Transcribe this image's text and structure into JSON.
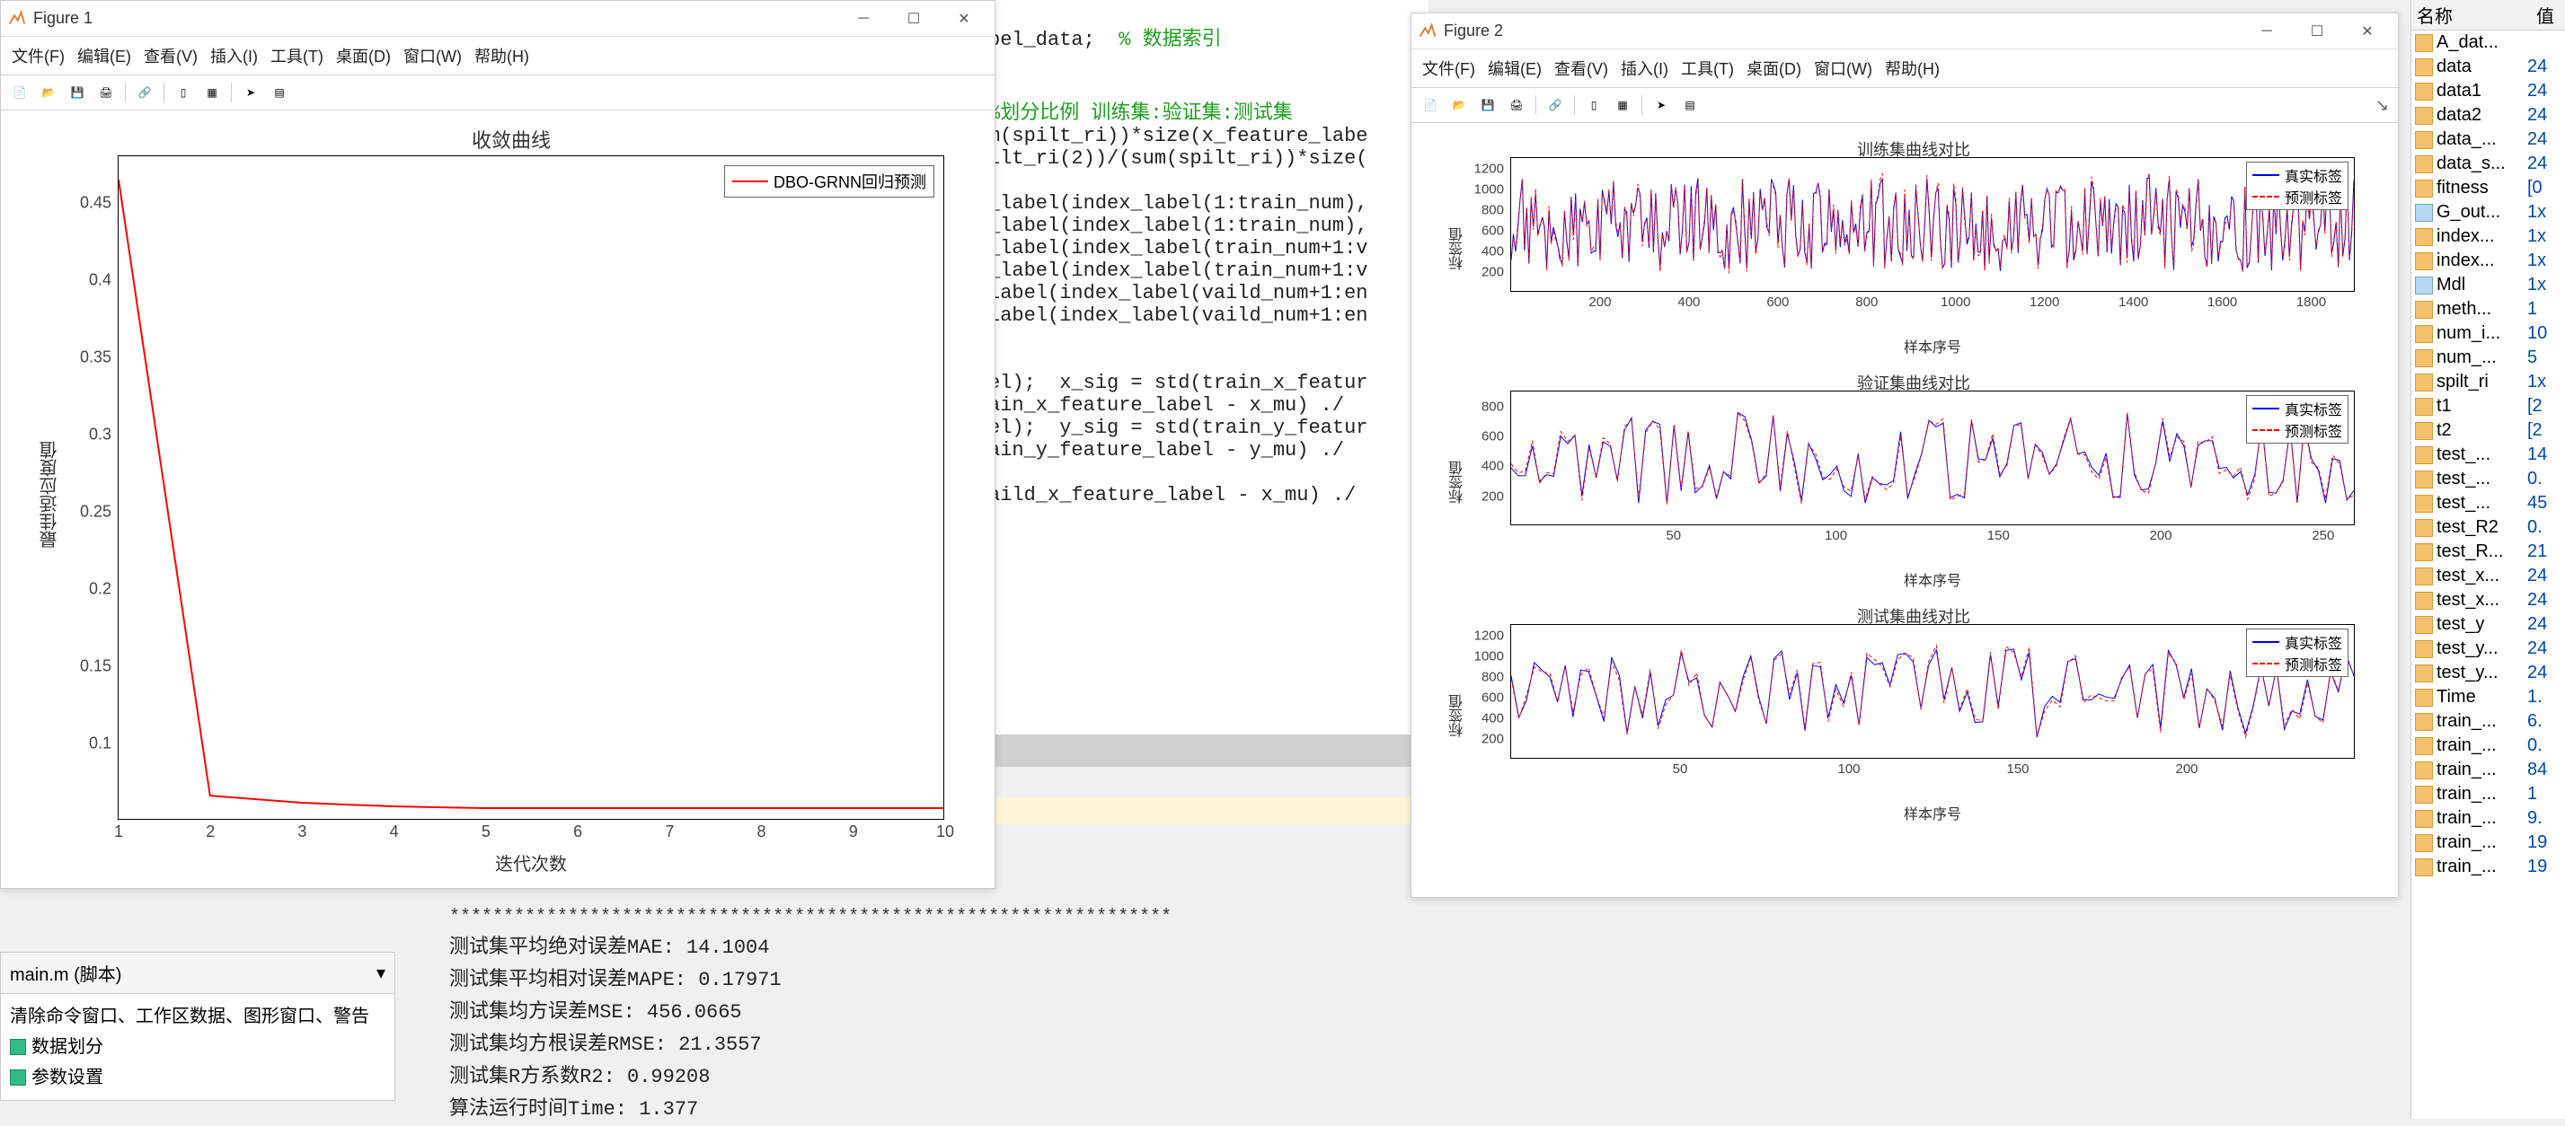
{
  "figure1": {
    "title": "Figure 1",
    "menu": [
      "文件(F)",
      "编辑(E)",
      "查看(V)",
      "插入(I)",
      "工具(T)",
      "桌面(D)",
      "窗口(W)",
      "帮助(H)"
    ]
  },
  "figure2": {
    "title": "Figure 2",
    "menu": [
      "文件(F)",
      "编辑(E)",
      "查看(V)",
      "插入(I)",
      "工具(T)",
      "桌面(D)",
      "窗口(W)",
      "帮助(H)"
    ]
  },
  "chart_data": [
    {
      "type": "line",
      "title": "收敛曲线",
      "xlabel": "迭代次数",
      "ylabel": "最佳适应度值",
      "xlim": [
        1,
        10
      ],
      "ylim": [
        0.05,
        0.48
      ],
      "xticks": [
        1,
        2,
        3,
        4,
        5,
        6,
        7,
        8,
        9,
        10
      ],
      "yticks": [
        0.1,
        0.15,
        0.2,
        0.25,
        0.3,
        0.35,
        0.4,
        0.45
      ],
      "series": [
        {
          "name": "DBO-GRNN回归预测",
          "color": "#ff0000",
          "x": [
            1,
            2,
            3,
            4,
            5,
            6,
            7,
            8,
            9,
            10
          ],
          "values": [
            0.465,
            0.065,
            0.06,
            0.058,
            0.057,
            0.057,
            0.057,
            0.057,
            0.057,
            0.057
          ]
        }
      ]
    },
    {
      "type": "line",
      "title": "训练集曲线对比",
      "xlabel": "样本序号",
      "ylabel": "标签值",
      "xlim": [
        0,
        1900
      ],
      "ylim": [
        0,
        1300
      ],
      "xticks": [
        200,
        400,
        600,
        800,
        1000,
        1200,
        1400,
        1600,
        1800
      ],
      "yticks": [
        200,
        400,
        600,
        800,
        1000,
        1200
      ],
      "series": [
        {
          "name": "真实标签",
          "color": "#0000ff",
          "style": "solid"
        },
        {
          "name": "预测标签",
          "color": "#ff0000",
          "style": "dashed"
        }
      ]
    },
    {
      "type": "line",
      "title": "验证集曲线对比",
      "xlabel": "样本序号",
      "ylabel": "标签值",
      "xlim": [
        0,
        260
      ],
      "ylim": [
        0,
        900
      ],
      "xticks": [
        50,
        100,
        150,
        200,
        250
      ],
      "yticks": [
        200,
        400,
        600,
        800
      ],
      "series": [
        {
          "name": "真实标签",
          "color": "#0000ff",
          "style": "solid"
        },
        {
          "name": "预测标签",
          "color": "#ff0000",
          "style": "dashed"
        }
      ]
    },
    {
      "type": "line",
      "title": "测试集曲线对比",
      "xlabel": "样本序号",
      "ylabel": "标签值",
      "xlim": [
        0,
        250
      ],
      "ylim": [
        0,
        1300
      ],
      "xticks": [
        50,
        100,
        150,
        200
      ],
      "yticks": [
        200,
        400,
        600,
        800,
        1000,
        1200
      ],
      "series": [
        {
          "name": "真实标签",
          "color": "#0000ff",
          "style": "solid"
        },
        {
          "name": "预测标签",
          "color": "#ff0000",
          "style": "dashed"
        }
      ]
    }
  ],
  "code": {
    "l1a": "bel_data;  ",
    "l1b": "% 数据索引",
    "l2": "",
    "l3": "%划分比例 训练集:验证集:测试集",
    "l4": "m(spilt_ri))*size(x_feature_labe",
    "l5": "ilt_ri(2))/(sum(spilt_ri))*size(",
    "l6": "",
    "l7": "_label(index_label(1:train_num),",
    "l8": "_label(index_label(1:train_num),",
    "l9": "_label(index_label(train_num+1:v",
    "l10": "_label(index_label(train_num+1:v",
    "l11": "label(index_label(vaild_num+1:en",
    "l12": "label(index_label(vaild_num+1:en",
    "l13": "",
    "l14": "el);  x_sig = std(train_x_featur",
    "l15": "ain_x_feature_label - x_mu) ./ ",
    "l16": "el);  y_sig = std(train_y_featur",
    "l17": "ain_y_feature_label - y_mu) ./ ",
    "l18": "",
    "l19": "aild_x_feature_label - x_mu) ./ "
  },
  "output": {
    "stars": "*******************************************************************",
    "l1": "测试集平均绝对误差MAE: 14.1004",
    "l2": "测试集平均相对误差MAPE: 0.17971",
    "l3": "测试集均方误差MSE: 456.0665",
    "l4": "测试集均方根误差RMSE: 21.3557",
    "l5": "测试集R方系数R2: 0.99208",
    "l6": "算法运行时间Time: 1.377"
  },
  "script_panel": {
    "tab": "main.m  (脚本)",
    "line1": "清除命令窗口、工作区数据、图形窗口、警告",
    "line2": "数据划分",
    "line3": "参数设置"
  },
  "workspace": {
    "header_name": "名称",
    "header_val": "值",
    "rows": [
      {
        "name": "A_dat...",
        "val": "",
        "icon": "num"
      },
      {
        "name": "data",
        "val": "24",
        "icon": "num"
      },
      {
        "name": "data1",
        "val": "24",
        "icon": "num"
      },
      {
        "name": "data2",
        "val": "24",
        "icon": "num"
      },
      {
        "name": "data_...",
        "val": "24",
        "icon": "num"
      },
      {
        "name": "data_s...",
        "val": "24",
        "icon": "num"
      },
      {
        "name": "fitness",
        "val": "[0",
        "icon": "num"
      },
      {
        "name": "G_out...",
        "val": "1x",
        "icon": "struct"
      },
      {
        "name": "index...",
        "val": "1x",
        "icon": "num"
      },
      {
        "name": "index...",
        "val": "1x",
        "icon": "num"
      },
      {
        "name": "Mdl",
        "val": "1x",
        "icon": "struct"
      },
      {
        "name": "meth...",
        "val": "1",
        "icon": "num"
      },
      {
        "name": "num_i...",
        "val": "10",
        "icon": "num"
      },
      {
        "name": "num_...",
        "val": "5",
        "icon": "num"
      },
      {
        "name": "spilt_ri",
        "val": "1x",
        "icon": "num"
      },
      {
        "name": "t1",
        "val": "[2",
        "icon": "num"
      },
      {
        "name": "t2",
        "val": "[2",
        "icon": "num"
      },
      {
        "name": "test_...",
        "val": "14",
        "icon": "num"
      },
      {
        "name": "test_...",
        "val": "0.",
        "icon": "num"
      },
      {
        "name": "test_...",
        "val": "45",
        "icon": "num"
      },
      {
        "name": "test_R2",
        "val": "0.",
        "icon": "num"
      },
      {
        "name": "test_R...",
        "val": "21",
        "icon": "num"
      },
      {
        "name": "test_x...",
        "val": "24",
        "icon": "num"
      },
      {
        "name": "test_x...",
        "val": "24",
        "icon": "num"
      },
      {
        "name": "test_y",
        "val": "24",
        "icon": "num"
      },
      {
        "name": "test_y...",
        "val": "24",
        "icon": "num"
      },
      {
        "name": "test_y...",
        "val": "24",
        "icon": "num"
      },
      {
        "name": "Time",
        "val": "1.",
        "icon": "num"
      },
      {
        "name": "train_...",
        "val": "6.",
        "icon": "num"
      },
      {
        "name": "train_...",
        "val": "0.",
        "icon": "num"
      },
      {
        "name": "train_...",
        "val": "84",
        "icon": "num"
      },
      {
        "name": "train_...",
        "val": "1",
        "icon": "num"
      },
      {
        "name": "train_...",
        "val": "9.",
        "icon": "num"
      },
      {
        "name": "train_...",
        "val": "19",
        "icon": "num"
      },
      {
        "name": "train_...",
        "val": "19",
        "icon": "num"
      }
    ]
  }
}
